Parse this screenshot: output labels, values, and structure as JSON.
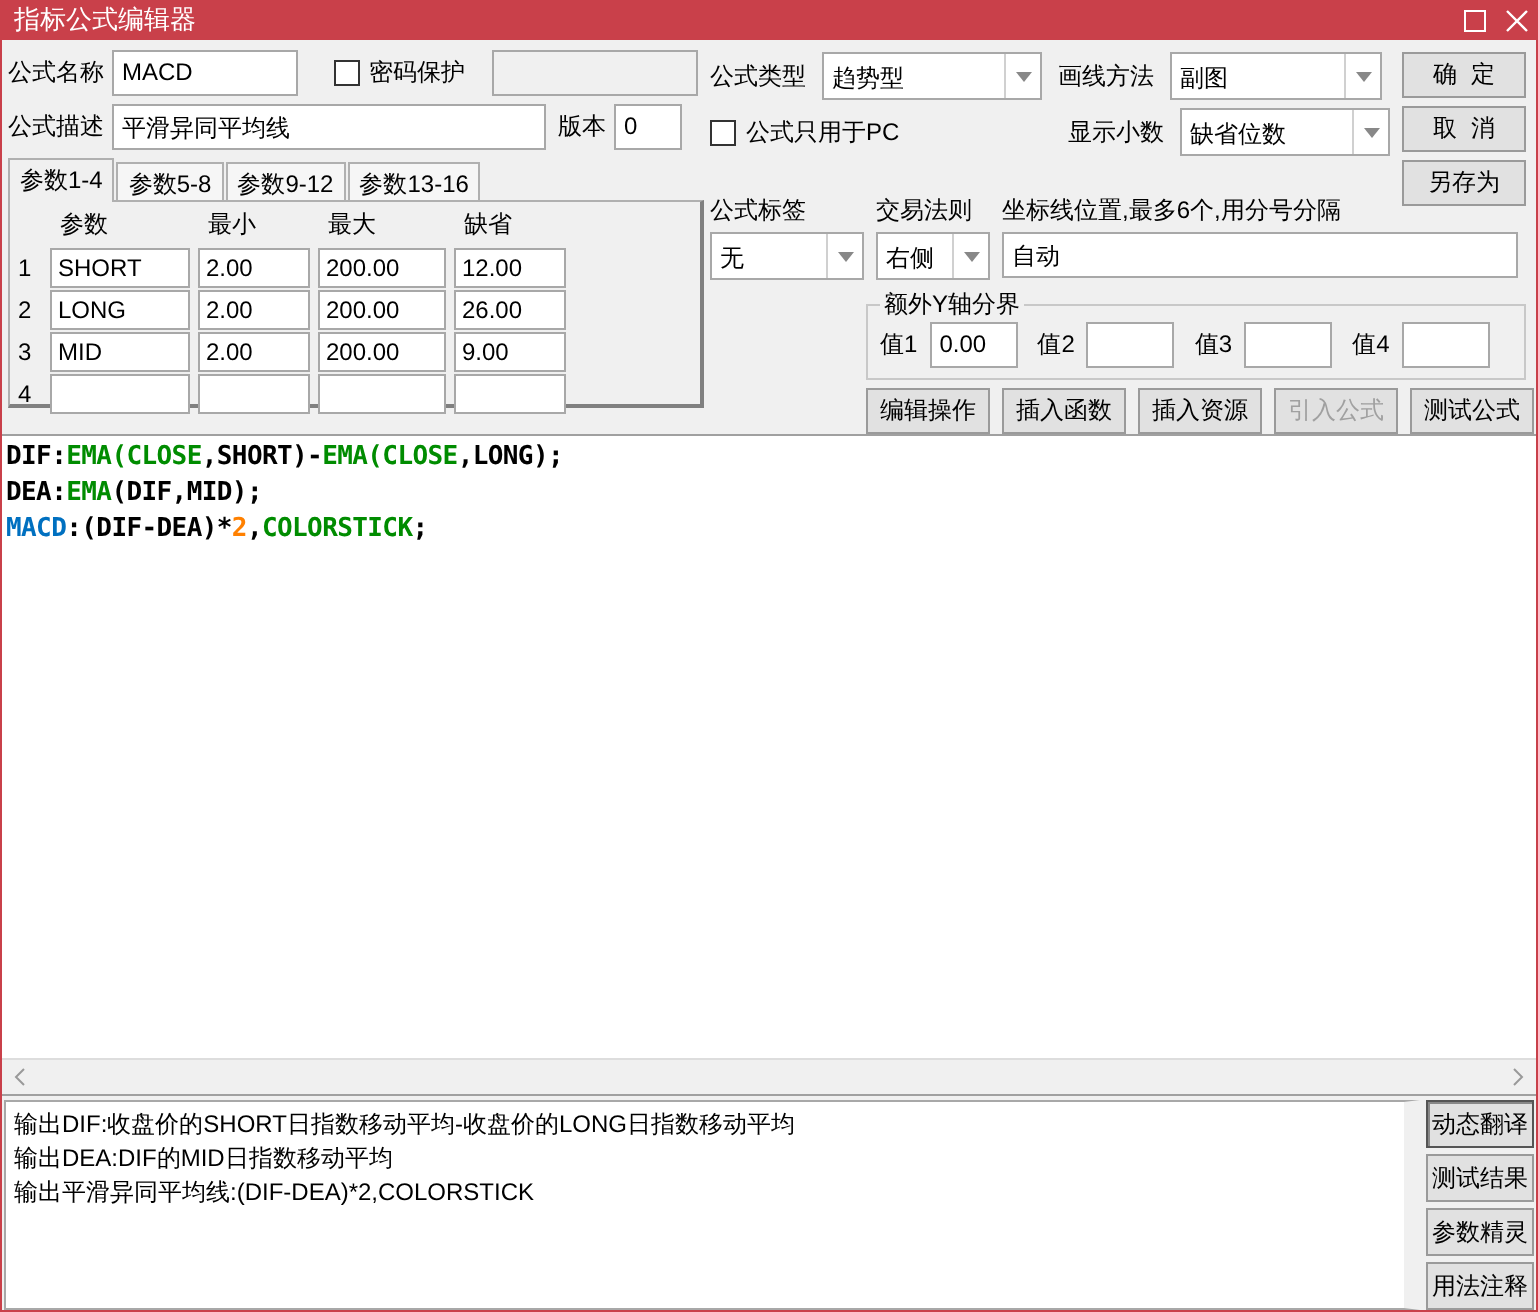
{
  "window": {
    "title": "指标公式编辑器"
  },
  "name_field": {
    "label": "公式名称",
    "value": "MACD"
  },
  "password": {
    "label": "密码保护",
    "checked": false
  },
  "description_field": {
    "label": "公式描述",
    "value": "平滑异同平均线"
  },
  "version_field": {
    "label": "版本",
    "value": "0"
  },
  "formula_type": {
    "label": "公式类型",
    "value": "趋势型"
  },
  "draw_method": {
    "label": "画线方法",
    "value": "副图"
  },
  "pc_only": {
    "label": "公式只用于PC",
    "checked": false
  },
  "decimals": {
    "label": "显示小数",
    "value": "缺省位数"
  },
  "side_buttons": [
    {
      "label": "确  定"
    },
    {
      "label": "取  消"
    },
    {
      "label": "另存为"
    }
  ],
  "param_tabs": [
    {
      "label": "参数1-4",
      "selected": true
    },
    {
      "label": "参数5-8",
      "selected": false
    },
    {
      "label": "参数9-12",
      "selected": false
    },
    {
      "label": "参数13-16",
      "selected": false
    }
  ],
  "param_table": {
    "columns": [
      "参数",
      "最小",
      "最大",
      "缺省"
    ],
    "rows": [
      {
        "index": "1",
        "cells": [
          "SHORT",
          "2.00",
          "200.00",
          "12.00"
        ]
      },
      {
        "index": "2",
        "cells": [
          "LONG",
          "2.00",
          "200.00",
          "26.00"
        ]
      },
      {
        "index": "3",
        "cells": [
          "MID",
          "2.00",
          "200.00",
          "9.00"
        ]
      },
      {
        "index": "4",
        "cells": []
      }
    ]
  },
  "formula_tag": {
    "label": "公式标签",
    "value": "无"
  },
  "trade_rule": {
    "label": "交易法则",
    "value": "右侧"
  },
  "axis_lines": {
    "label": "坐标线位置,最多6个,用分号分隔",
    "value": "自动"
  },
  "y_bounds": {
    "title": "额外Y轴分界",
    "fields": [
      {
        "label": "值1",
        "value": "0.00"
      },
      {
        "label": "值2"
      },
      {
        "label": "值3"
      },
      {
        "label": "值4"
      }
    ]
  },
  "action_buttons": [
    {
      "label": "编辑操作",
      "disabled": false
    },
    {
      "label": "插入函数",
      "disabled": false
    },
    {
      "label": "插入资源",
      "disabled": false
    },
    {
      "label": "引入公式",
      "disabled": true
    },
    {
      "label": "测试公式",
      "disabled": false
    }
  ],
  "code_lines": [
    [
      {
        "text": "DIF:",
        "kind": "plain"
      },
      {
        "text": "EMA(CLOSE",
        "kind": "function"
      },
      {
        "text": ",SHORT)-",
        "kind": "plain"
      },
      {
        "text": "EMA(CLOSE",
        "kind": "function"
      },
      {
        "text": ",LONG);",
        "kind": "plain"
      }
    ],
    [
      {
        "text": "DEA:",
        "kind": "plain"
      },
      {
        "text": "EMA",
        "kind": "function"
      },
      {
        "text": "(DIF,MID);",
        "kind": "plain"
      }
    ],
    [
      {
        "text": "MACD",
        "kind": "output"
      },
      {
        "text": ":(DIF-DEA)*",
        "kind": "plain"
      },
      {
        "text": "2",
        "kind": "number"
      },
      {
        "text": ",",
        "kind": "plain"
      },
      {
        "text": "COLORSTICK",
        "kind": "function"
      },
      {
        "text": ";",
        "kind": "plain"
      }
    ]
  ],
  "translation_lines": [
    "输出DIF:收盘价的SHORT日指数移动平均-收盘价的LONG日指数移动平均",
    "输出DEA:DIF的MID日指数移动平均",
    "输出平滑异同平均线:(DIF-DEA)*2,COLORSTICK"
  ],
  "bottom_buttons": [
    {
      "label": "动态翻译",
      "selected": true
    },
    {
      "label": "测试结果",
      "selected": false
    },
    {
      "label": "参数精灵",
      "selected": false
    },
    {
      "label": "用法注释",
      "selected": false
    }
  ]
}
